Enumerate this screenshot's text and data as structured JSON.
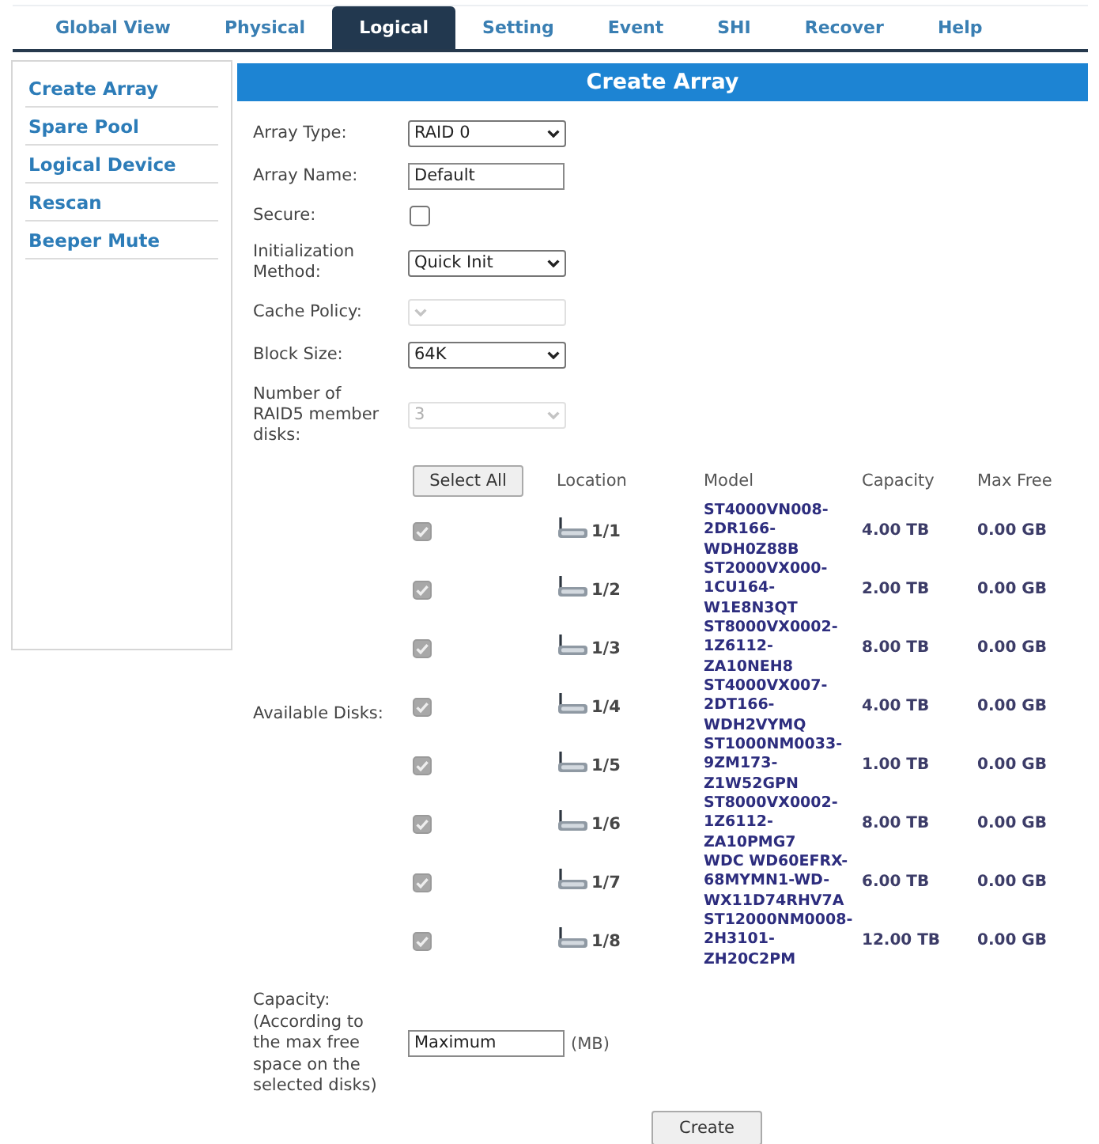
{
  "tabs": [
    {
      "label": "Global View",
      "selected": false
    },
    {
      "label": "Physical",
      "selected": false
    },
    {
      "label": "Logical",
      "selected": true
    },
    {
      "label": "Setting",
      "selected": false
    },
    {
      "label": "Event",
      "selected": false
    },
    {
      "label": "SHI",
      "selected": false
    },
    {
      "label": "Recover",
      "selected": false
    },
    {
      "label": "Help",
      "selected": false
    }
  ],
  "sidebar": {
    "items": [
      "Create Array",
      "Spare Pool",
      "Logical Device",
      "Rescan",
      "Beeper Mute"
    ]
  },
  "panel": {
    "title": "Create Array",
    "fields": [
      {
        "kind": "select",
        "label": "Array Type:",
        "value": "RAID 0",
        "disabled": false
      },
      {
        "kind": "text",
        "label": "Array Name:",
        "value": "Default"
      },
      {
        "kind": "checkbox",
        "label": "Secure:",
        "checked": false
      },
      {
        "kind": "select",
        "label": "Initialization Method:",
        "value": "Quick Init",
        "disabled": false
      },
      {
        "kind": "select",
        "label": "Cache Policy:",
        "disabled": true
      },
      {
        "kind": "select",
        "label": "Block Size:",
        "value": "64K",
        "disabled": false
      },
      {
        "kind": "select",
        "label": "Number of RAID5 member disks:",
        "value": "3",
        "disabled": true
      }
    ],
    "disks": {
      "label": "Available Disks:",
      "select_all": "Select All",
      "columns": [
        "Location",
        "Model",
        "Capacity",
        "Max Free"
      ],
      "rows": [
        {
          "checked": true,
          "disabled": true,
          "location": "1/1",
          "model": "ST4000VN008-2DR166-WDH0Z88B",
          "capacity": "4.00 TB",
          "max_free": "0.00 GB"
        },
        {
          "checked": true,
          "disabled": true,
          "location": "1/2",
          "model": "ST2000VX000-1CU164-W1E8N3QT",
          "capacity": "2.00 TB",
          "max_free": "0.00 GB"
        },
        {
          "checked": true,
          "disabled": true,
          "location": "1/3",
          "model": "ST8000VX0002-1Z6112-ZA10NEH8",
          "capacity": "8.00 TB",
          "max_free": "0.00 GB"
        },
        {
          "checked": true,
          "disabled": true,
          "location": "1/4",
          "model": "ST4000VX007-2DT166-WDH2VYMQ",
          "capacity": "4.00 TB",
          "max_free": "0.00 GB"
        },
        {
          "checked": true,
          "disabled": true,
          "location": "1/5",
          "model": "ST1000NM0033-9ZM173-Z1W52GPN",
          "capacity": "1.00 TB",
          "max_free": "0.00 GB"
        },
        {
          "checked": true,
          "disabled": true,
          "location": "1/6",
          "model": "ST8000VX0002-1Z6112-ZA10PMG7",
          "capacity": "8.00 TB",
          "max_free": "0.00 GB"
        },
        {
          "checked": true,
          "disabled": true,
          "location": "1/7",
          "model": "WDC WD60EFRX-68MYMN1-WD-WX11D74RHV7A",
          "capacity": "6.00 TB",
          "max_free": "0.00 GB"
        },
        {
          "checked": true,
          "disabled": true,
          "location": "1/8",
          "model": "ST12000NM0008-2H3101-ZH20C2PM",
          "capacity": "12.00 TB",
          "max_free": "0.00 GB"
        }
      ]
    },
    "capacity": {
      "label": "Capacity: (According to the max free space on the selected disks)",
      "value": "Maximum",
      "unit": "(MB)"
    },
    "create_button": "Create"
  }
}
